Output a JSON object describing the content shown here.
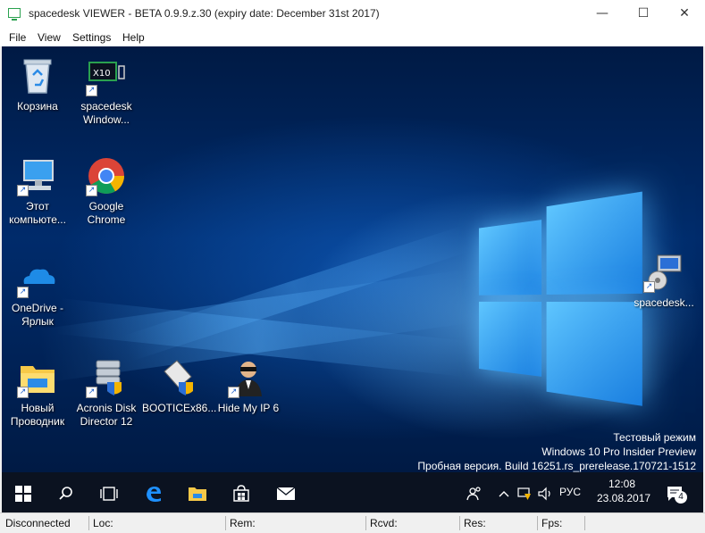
{
  "window": {
    "title": "spacedesk VIEWER - BETA 0.9.9.z.30 (expiry date: December 31st 2017)",
    "minimize_glyph": "—",
    "maximize_glyph": "☐",
    "close_glyph": "✕"
  },
  "menu": {
    "items": [
      "File",
      "View",
      "Settings",
      "Help"
    ]
  },
  "desktop": {
    "icons": [
      {
        "label": [
          "Корзина"
        ],
        "icon": "recycle-bin-icon"
      },
      {
        "label": [
          "spacedesk",
          "Window..."
        ],
        "icon": "spacedesk-icon"
      },
      {
        "label": [
          "Этот",
          "компьюте..."
        ],
        "icon": "this-pc-icon"
      },
      {
        "label": [
          "Google",
          "Chrome"
        ],
        "icon": "chrome-icon"
      },
      {
        "label": [
          "OneDrive -",
          "Ярлык"
        ],
        "icon": "onedrive-icon"
      },
      {
        "label": [
          "Новый",
          "Проводник"
        ],
        "icon": "folder-icon"
      },
      {
        "label": [
          "Acronis Disk",
          "Director 12"
        ],
        "icon": "acronis-icon"
      },
      {
        "label": [
          "BOOTICEx86..."
        ],
        "icon": "bootice-icon"
      },
      {
        "label": [
          "Hide My IP 6"
        ],
        "icon": "hide-my-ip-icon"
      },
      {
        "label": [
          "spacedesk..."
        ],
        "icon": "spacedesk-installer-icon"
      }
    ],
    "spacedesk_icon_text": "X10",
    "watermark": {
      "line1": "Тестовый режим",
      "line2": "Windows 10 Pro Insider Preview",
      "line3": "Пробная версия. Build 16251.rs_prerelease.170721-1512"
    }
  },
  "taskbar": {
    "language": "РУС",
    "time": "12:08",
    "date": "23.08.2017",
    "notification_count": "4"
  },
  "statusbar": {
    "connection": "Disconnected",
    "loc": "Loc:",
    "rem": "Rem:",
    "rcvd": "Rcvd:",
    "res": "Res:",
    "fps": "Fps:"
  },
  "colors": {
    "taskbar": "#0b1220",
    "desktop_blue": "#002b6b",
    "accent": "#5fc6ff"
  }
}
